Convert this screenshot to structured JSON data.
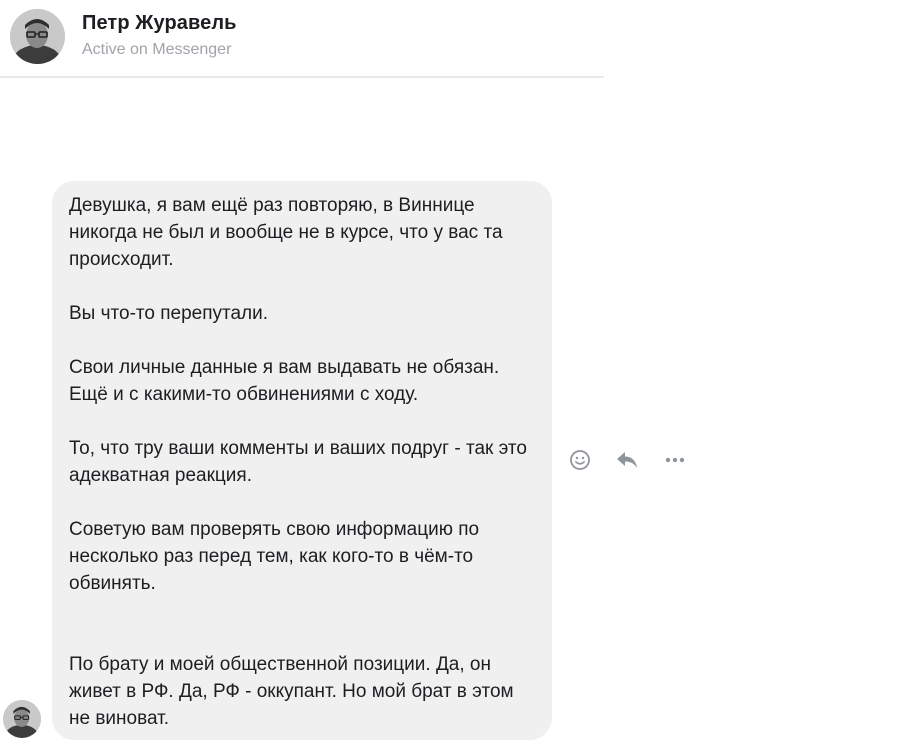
{
  "header": {
    "name": "Петр Журавель",
    "status": "Active on Messenger"
  },
  "message": {
    "paragraphs": [
      "Девушка, я вам ещё раз повторяю, в Виннице никогда не был и вообще не в курсе, что у вас та происходит.",
      "Вы что-то перепутали.",
      "Свои личные данные я вам выдавать не обязан. Ещё и с какими-то обвинениями с ходу.",
      "То, что тру ваши комменты и ваших подруг - так это адекватная реакция.",
      "Советую вам проверять свою информацию по несколько раз перед тем, как кого-то в чём-то обвинять.",
      "По брату и моей общественной позиции. Да, он живет в РФ. Да, РФ - оккупант. Но мой брат в этом не виноват."
    ]
  },
  "actions": {
    "icons": [
      "smiley-icon",
      "reply-icon",
      "more-icon"
    ]
  },
  "colors": {
    "bubble": "#f0f0f0",
    "text": "#1c1e21",
    "muted": "#a0a3a8",
    "icon": "#90949c"
  }
}
